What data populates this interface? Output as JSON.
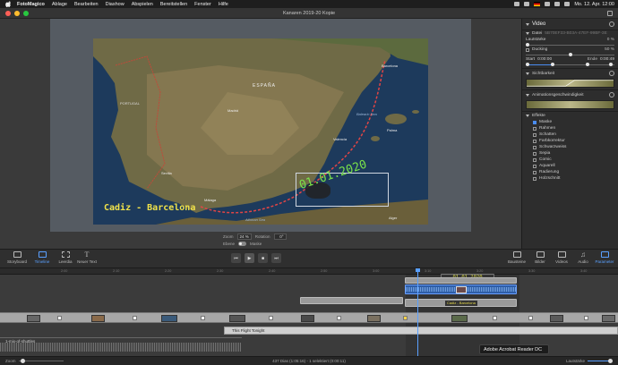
{
  "menubar": {
    "app": "FotoMagico",
    "items": [
      "Ablage",
      "Bearbeiten",
      "Diashow",
      "Abspielen",
      "Bereitstellen",
      "Fenster",
      "Hilfe"
    ],
    "clock": "Mo. 12. Apr.  12:00"
  },
  "window": {
    "title": "Kanaren 2019-20 Kopie"
  },
  "map": {
    "labels": {
      "portugal": "PORTUGAL",
      "spain": "ESPAÑA",
      "cadiz_barcelona": "Cadiz - Barcelona",
      "date": "01.01.2020",
      "balearic": "Balearic Sea",
      "alboran": "Alboran Sea",
      "madrid": "Madrid",
      "valencia": "Valencia",
      "barcelona": "Barcelona",
      "sevilla": "Sevilla",
      "malaga": "Málaga",
      "algeria": "Alger",
      "mallorca": "Palma"
    }
  },
  "stage_controls": {
    "zoom_label": "Zoom",
    "zoom_value": "24 %",
    "rotation_label": "Rotation",
    "rotation_value": "0°",
    "layer_label": "Ebene",
    "mask_label": "Maske"
  },
  "inspector": {
    "header": "Video",
    "file_label": "Datei",
    "file_value": "5B70EF33-B03A-47EF-99BF-3E...",
    "volume_label": "Lautstärke",
    "volume_value": "0 %",
    "ducking_label": "Ducking",
    "ducking_value": "50 %",
    "start_label": "Start",
    "start_value": "0:00:00",
    "end_label": "Ende",
    "end_value": "0:00:49",
    "visibility_label": "Sichtbarkeit",
    "anim_label": "Animationsgeschwindigkeit",
    "effects_label": "Effekte",
    "effects": [
      {
        "label": "Maske",
        "on": true
      },
      {
        "label": "Rahmen",
        "on": false
      },
      {
        "label": "Schatten",
        "on": false
      },
      {
        "label": "Farbkorrektur",
        "on": false
      },
      {
        "label": "Schwarzweiss",
        "on": false
      },
      {
        "label": "Sepia",
        "on": false
      },
      {
        "label": "Comic",
        "on": false
      },
      {
        "label": "Aquarell",
        "on": false
      },
      {
        "label": "Radierung",
        "on": false
      },
      {
        "label": "Holzschnitt",
        "on": false
      }
    ]
  },
  "toolbar": {
    "storyboard": "Storyboard",
    "timeline": "Timeline",
    "leerdia": "Leerdia",
    "neuer_text": "Neuer Text",
    "bausteine": "Bausteine",
    "bilder": "Bilder",
    "videos": "Videos",
    "audio": "Audio",
    "parameter": "Parameter",
    "transport": {
      "rewind": "⏮",
      "play": "▶",
      "stop": "■",
      "forward": "⏭"
    }
  },
  "timeline": {
    "ticks": [
      "2:00",
      "2:10",
      "2:20",
      "2:30",
      "2:40",
      "2:50",
      "3:00",
      "3:10",
      "3:20",
      "3:30",
      "3:40"
    ],
    "date_clip": "01.01.2020",
    "small_clip": "Cadiz - Barcelona",
    "audio1": "This Flight Tonight",
    "audio2": "1-mix-of-shuttles"
  },
  "statusbar": {
    "zoom_label": "Zoom",
    "info": "437 Dias (1:05:16) - 1 selektiert (0:00:11)",
    "volume_label": "Lautstärke"
  },
  "tooltip": "Adobe Acrobat Reader DC"
}
